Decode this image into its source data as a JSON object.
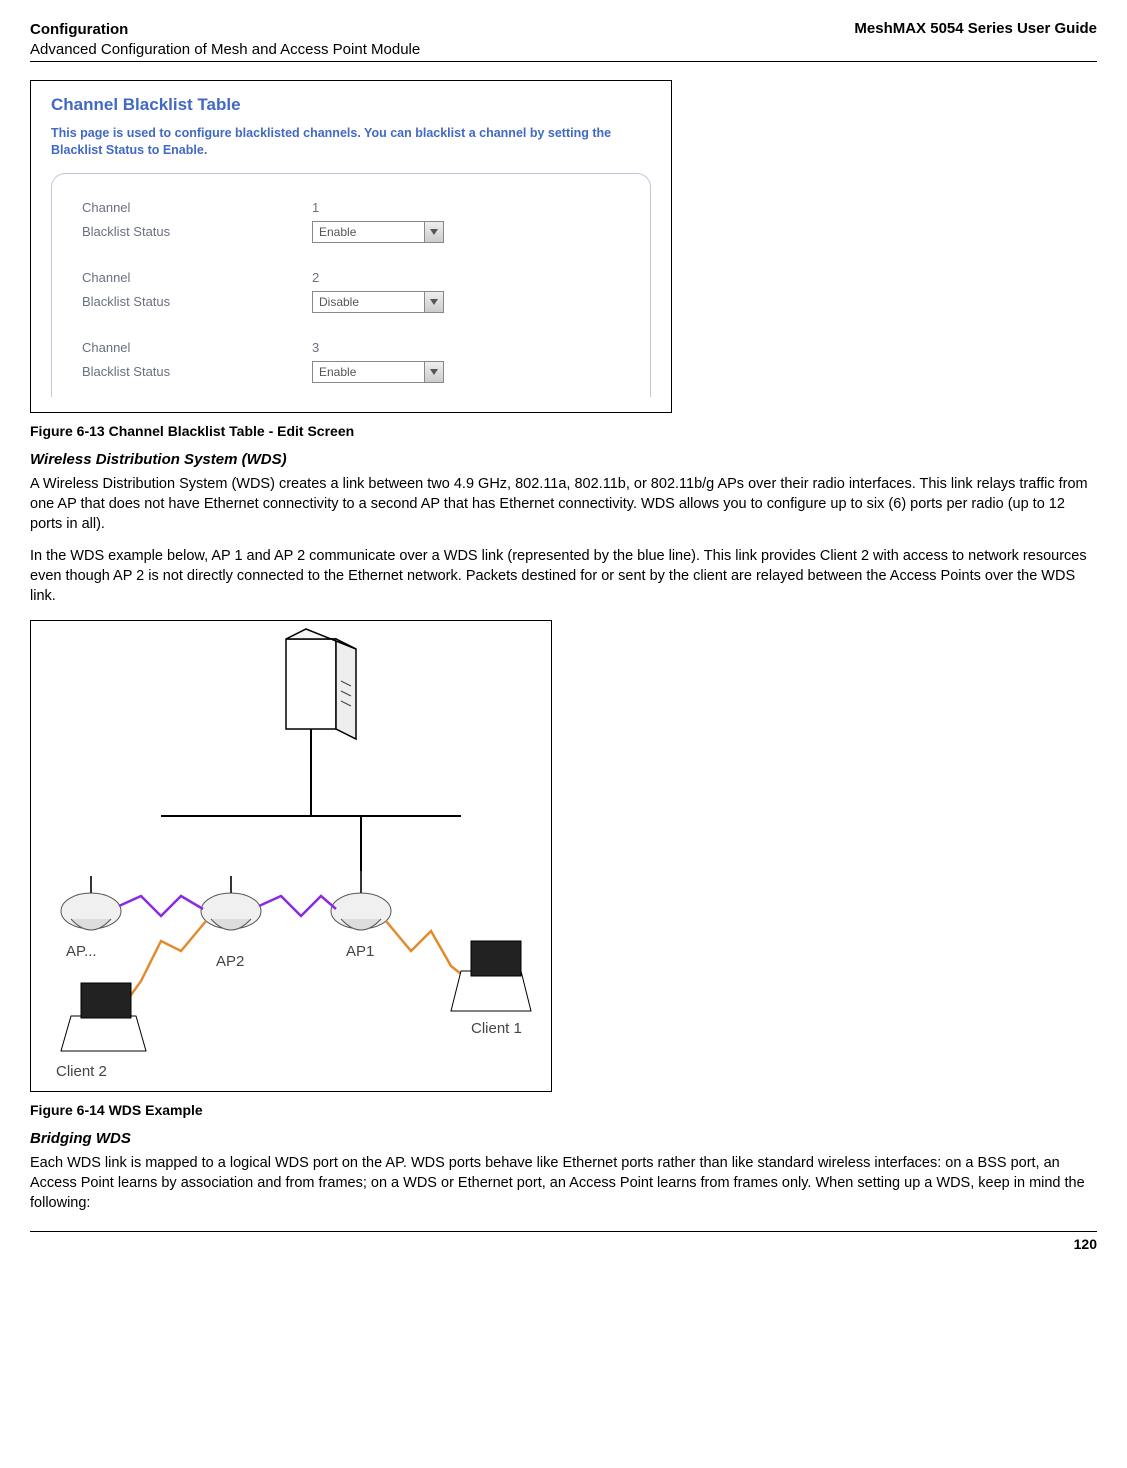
{
  "header": {
    "section": "Configuration",
    "subsection": "Advanced Configuration of Mesh and Access Point Module",
    "guide": "MeshMAX 5054 Series User Guide"
  },
  "blacklist_panel": {
    "title": "Channel Blacklist Table",
    "description": "This page is used to configure blacklisted channels. You can blacklist a channel by setting the Blacklist Status to Enable.",
    "rows": [
      {
        "channel_label": "Channel",
        "channel_value": "1",
        "status_label": "Blacklist Status",
        "status_value": "Enable"
      },
      {
        "channel_label": "Channel",
        "channel_value": "2",
        "status_label": "Blacklist Status",
        "status_value": "Disable"
      },
      {
        "channel_label": "Channel",
        "channel_value": "3",
        "status_label": "Blacklist Status",
        "status_value": "Enable"
      }
    ]
  },
  "fig613_caption": "Figure 6-13 Channel Blacklist Table - Edit Screen",
  "wds_section_title": "Wireless Distribution System (WDS)",
  "wds_para1": "A Wireless Distribution System (WDS) creates a link between two 4.9 GHz, 802.11a, 802.11b, or 802.11b/g APs over their radio interfaces. This link relays traffic from one AP that does not have Ethernet connectivity to a second AP that has Ethernet connectivity. WDS allows you to configure up to six (6) ports per radio (up to 12 ports in all).",
  "wds_para2": "In the WDS example below, AP 1 and AP 2 communicate over a WDS link (represented by the blue line). This link provides Client 2 with access to network resources even though AP 2 is not directly connected to the Ethernet network. Packets destined for or sent by the client are relayed between the Access Points over the WDS link.",
  "diagram_labels": {
    "ap_dots": "AP...",
    "ap2": "AP2",
    "ap1": "AP1",
    "client1": "Client 1",
    "client2": "Client 2"
  },
  "fig614_caption": "Figure 6-14 WDS Example",
  "bridging_title": "Bridging WDS",
  "bridging_para": "Each WDS link is mapped to a logical WDS port on the AP. WDS ports behave like Ethernet ports rather than like standard wireless interfaces: on a BSS port, an Access Point learns by association and from frames; on a WDS or Ethernet port, an Access Point learns from frames only. When setting up a WDS, keep in mind the following:",
  "page_number": "120"
}
